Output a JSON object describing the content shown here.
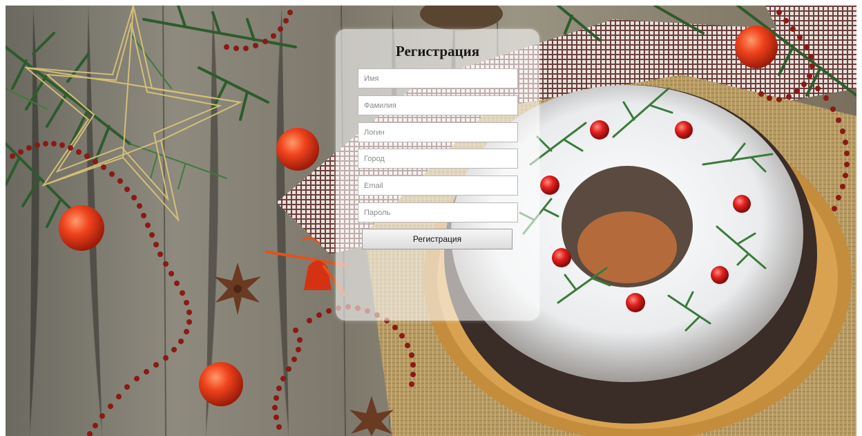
{
  "form": {
    "title": "Регистрация",
    "fields": [
      {
        "placeholder": "Имя",
        "value": ""
      },
      {
        "placeholder": "Фамилия",
        "value": ""
      },
      {
        "placeholder": "Логин",
        "value": ""
      },
      {
        "placeholder": "Город",
        "value": ""
      },
      {
        "placeholder": "Email",
        "value": ""
      },
      {
        "placeholder": "Пароль",
        "value": ""
      }
    ],
    "submit_label": "Регистрация"
  },
  "colors": {
    "panel_background": "#ffffff",
    "field_border": "#b8b8b8",
    "button_gradient_top": "#f6f6f6",
    "button_gradient_bottom": "#dcdcdc"
  },
  "background_image": {
    "subject": "christmas-cake-photo"
  }
}
